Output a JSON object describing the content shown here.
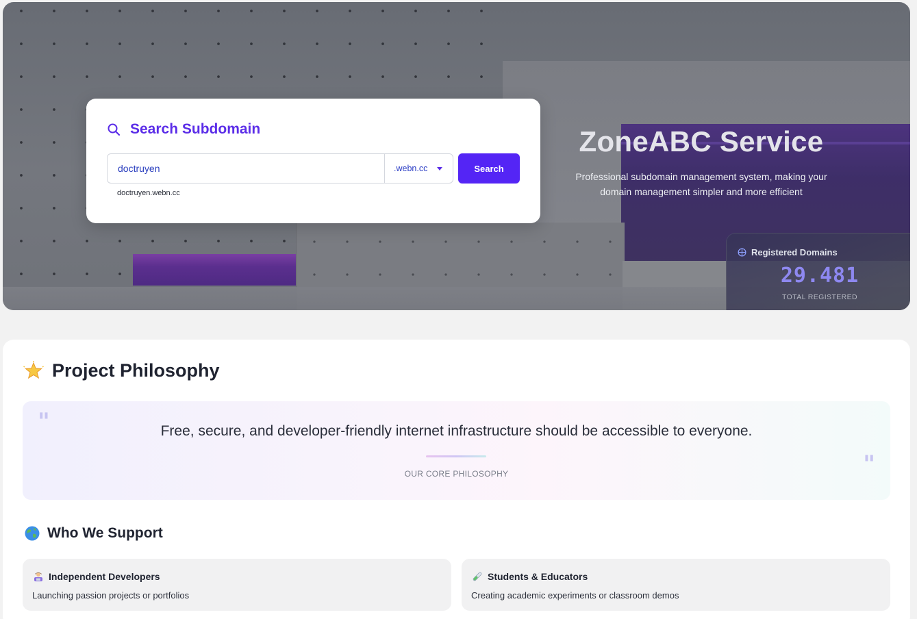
{
  "hero": {
    "title": "ZoneABC Service",
    "subtitle_line1": "Professional subdomain management system, making your",
    "subtitle_line2": "domain management simpler and more efficient",
    "stats": {
      "label": "Registered Domains",
      "value": "29.481",
      "caption": "TOTAL REGISTERED"
    }
  },
  "search": {
    "title": "Search Subdomain",
    "input_value": "doctruyen",
    "suffix": ".webn.cc",
    "button_label": "Search",
    "preview": "doctruyen.webn.cc"
  },
  "philosophy": {
    "title": "Project Philosophy",
    "quote": "Free, secure, and developer-friendly internet infrastructure should be accessible to everyone.",
    "caption": "OUR CORE PHILOSOPHY"
  },
  "support": {
    "title": "Who We Support",
    "items": [
      {
        "icon": "technologist-icon",
        "title": "Independent Developers",
        "desc": "Launching passion projects or portfolios"
      },
      {
        "icon": "test-tube-icon",
        "title": "Students & Educators",
        "desc": "Creating academic experiments or classroom demos"
      }
    ]
  },
  "colors": {
    "accent": "#5425f5",
    "stat_value": "#8e88f0",
    "page_bg": "#f2f2f2"
  }
}
